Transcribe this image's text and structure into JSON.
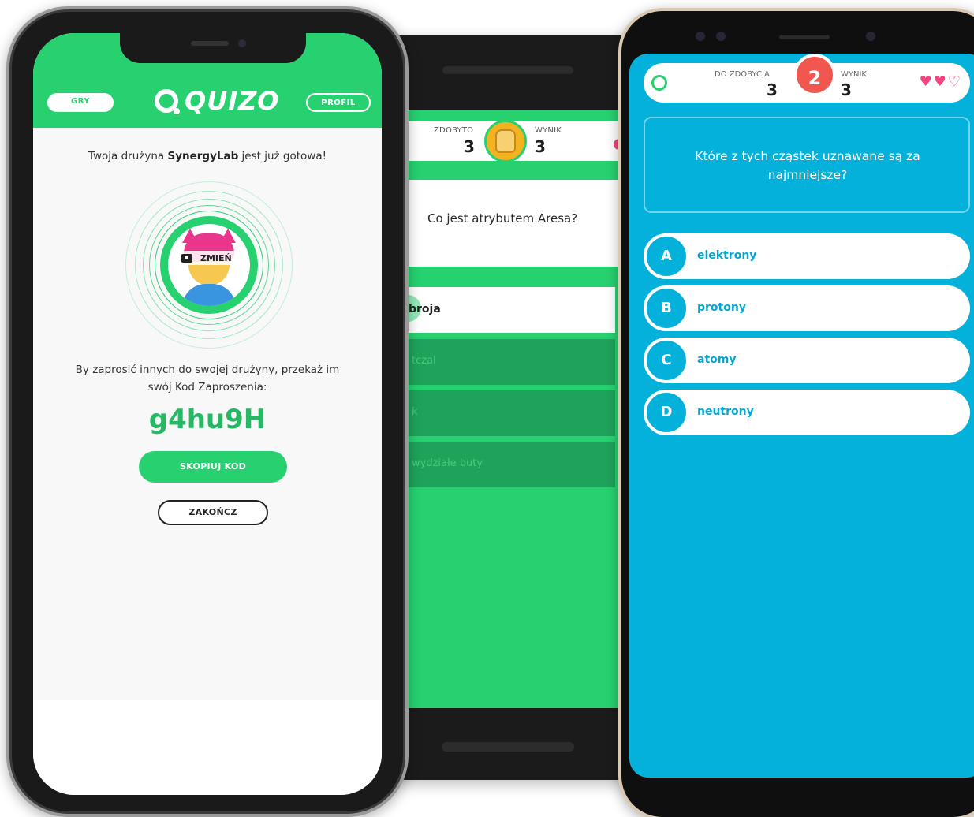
{
  "left_phone": {
    "header": {
      "games_button": "GRY",
      "logo_text": "QUIZO",
      "profile_button": "PROFIL"
    },
    "team_ready": {
      "prefix": "Twoja drużyna ",
      "team_name": "SynergyLab",
      "suffix": " jest już gotowa!"
    },
    "avatar": {
      "change_label": "ZMIEŃ"
    },
    "invite_text": "By zaprosić innych do swojej drużyny, przekaż im swój Kod Zaproszenia:",
    "invite_code": "g4hu9H",
    "copy_button": "SKOPIUJ KOD",
    "finish_button": "ZAKOŃCZ"
  },
  "middle_phone": {
    "score": {
      "earned_label": "ZDOBYTO",
      "earned_value": "3",
      "score_label": "WYNIK",
      "score_value": "3"
    },
    "question": "Co jest atrybutem Aresa?",
    "answers": [
      "broja",
      "tczal",
      "k",
      "wydziałe buty"
    ]
  },
  "right_phone": {
    "score": {
      "to_earn_label": "DO ZDOBYCIA",
      "to_earn_value": "3",
      "round": "2",
      "score_label": "WYNIK",
      "score_value": "3"
    },
    "lives": {
      "full": 2,
      "empty": 1
    },
    "question": "Które z tych cząstek uznawane są za najmniejsze?",
    "answers": [
      {
        "letter": "A",
        "text": "elektrony"
      },
      {
        "letter": "B",
        "text": "protony"
      },
      {
        "letter": "C",
        "text": "atomy"
      },
      {
        "letter": "D",
        "text": "neutrony"
      }
    ]
  },
  "colors": {
    "brand_green": "#27d170",
    "quiz_blue": "#04b1da",
    "heart_pink": "#f0467d",
    "round_red": "#f2574f"
  }
}
